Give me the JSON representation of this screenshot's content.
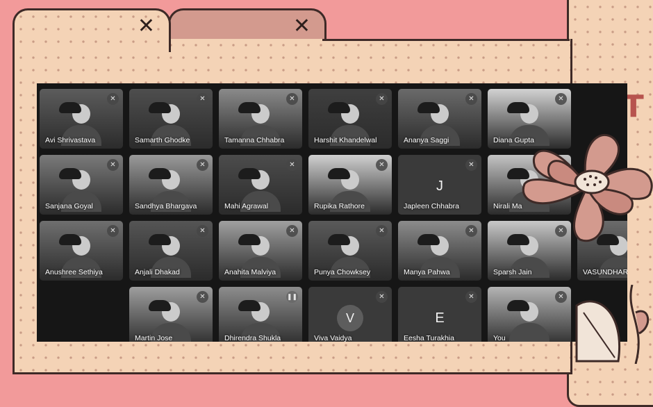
{
  "tabs": [
    {
      "close": "✕"
    },
    {
      "close": "✕"
    }
  ],
  "brand": {
    "text": "ST"
  },
  "participants": [
    {
      "name": "Avi Shrivastava",
      "tone": "#5c5c5c"
    },
    {
      "name": "Samarth Ghodke",
      "tone": "#4e4e4e"
    },
    {
      "name": "Tamanna Chhabra",
      "tone": "#8a8a8a"
    },
    {
      "name": "Harshit Khandelwal",
      "tone": "#3f3f3f"
    },
    {
      "name": "Ananya Saggi",
      "tone": "#6a6a6a"
    },
    {
      "name": "Diana Gupta",
      "tone": "#d2d2d2"
    },
    {
      "name": "Sanjana Goyal",
      "tone": "#7a7a7a"
    },
    {
      "name": "Sandhya Bhargava",
      "tone": "#9a9a9a"
    },
    {
      "name": "Mahi Agrawal",
      "tone": "#4c4c4c"
    },
    {
      "name": "Rupika Rathore",
      "tone": "#d0d0d0"
    },
    {
      "name": "Japleen Chhabra",
      "initial": "J"
    },
    {
      "name": "Nirali Ma",
      "tone": "#c4c4c4"
    },
    {
      "name": "Anushree Sethiya",
      "tone": "#6f6f6f"
    },
    {
      "name": "Anjali Dhakad",
      "tone": "#555555"
    },
    {
      "name": "Anahita Malviya",
      "tone": "#a0a0a0"
    },
    {
      "name": "Punya Chowksey",
      "tone": "#5a5a5a"
    },
    {
      "name": "Manya Pahwa",
      "tone": "#8c8c8c"
    },
    {
      "name": "Sparsh Jain",
      "tone": "#c8c8c8"
    },
    {
      "name": "VASUNDHARA",
      "tone": "#6b6b6b"
    },
    {
      "name": "Martin Jose",
      "tone": "#9e9e9e"
    },
    {
      "name": "Dhirendra Shukla",
      "tone": "#8d8d8d",
      "speaking": true
    },
    {
      "name": "Viva Vaidya",
      "initial": "V"
    },
    {
      "name": "Eesha Turakhia",
      "initial": "E"
    },
    {
      "name": "You",
      "tone": "#b4b4b4"
    }
  ]
}
